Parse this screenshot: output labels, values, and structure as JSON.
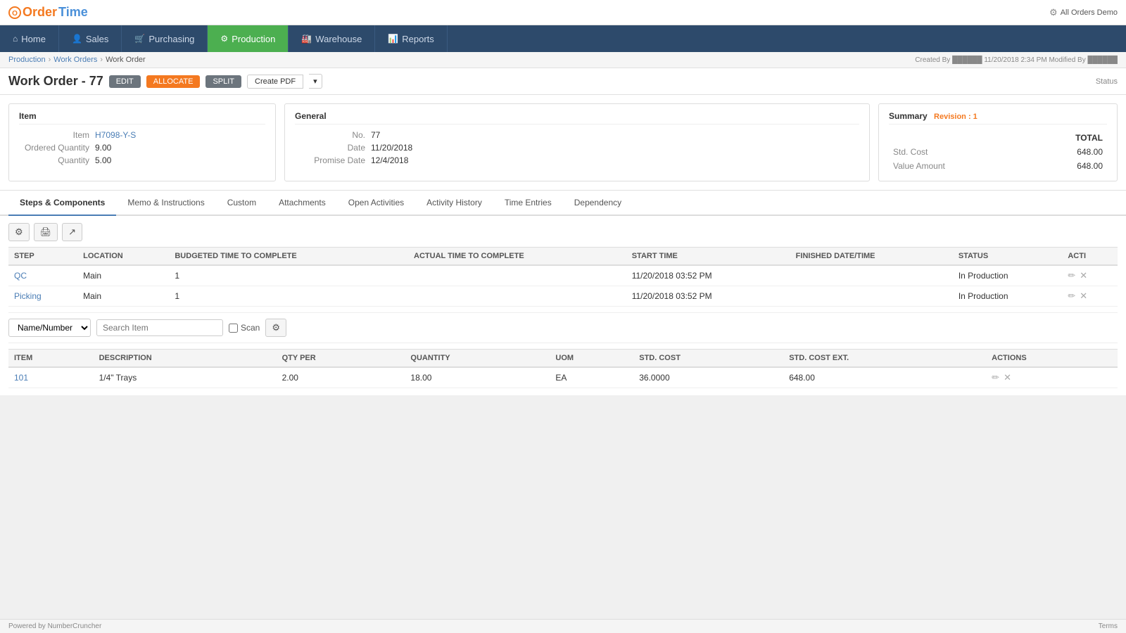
{
  "app": {
    "logo_order": "Order",
    "logo_time": "Time",
    "top_right": "All Orders Demo"
  },
  "nav": {
    "items": [
      {
        "id": "home",
        "label": "Home",
        "icon": "⌂",
        "active": false
      },
      {
        "id": "sales",
        "label": "Sales",
        "icon": "👤",
        "active": false
      },
      {
        "id": "purchasing",
        "label": "Purchasing",
        "icon": "🛒",
        "active": false
      },
      {
        "id": "production",
        "label": "Production",
        "icon": "⚙",
        "active": true
      },
      {
        "id": "warehouse",
        "label": "Warehouse",
        "icon": "🏭",
        "active": false
      },
      {
        "id": "reports",
        "label": "Reports",
        "icon": "📊",
        "active": false
      }
    ]
  },
  "breadcrumb": {
    "items": [
      "Production",
      "Work Orders",
      "Work Order"
    ],
    "separator": "›"
  },
  "created_info": "Created By ██████ 11/20/2018 2:34 PM  Modified By ██████",
  "page": {
    "title": "Work Order - 77",
    "btn_edit": "EDIT",
    "btn_allocate": "ALLOCATE",
    "btn_split": "SPLIT",
    "btn_create_pdf": "Create PDF",
    "btn_status": "Status"
  },
  "item_panel": {
    "heading": "Item",
    "item_label": "Item",
    "item_value": "H7098-Y-S",
    "ordered_qty_label": "Ordered Quantity",
    "ordered_qty_value": "9.00",
    "quantity_label": "Quantity",
    "quantity_value": "5.00"
  },
  "general_panel": {
    "heading": "General",
    "no_label": "No.",
    "no_value": "77",
    "date_label": "Date",
    "date_value": "11/20/2018",
    "promise_date_label": "Promise Date",
    "promise_date_value": "12/4/2018"
  },
  "summary_panel": {
    "heading": "Summary",
    "revision": "Revision : 1",
    "col_total": "TOTAL",
    "std_cost_label": "Std. Cost",
    "std_cost_value": "648.00",
    "value_amount_label": "Value Amount",
    "value_amount_value": "648.00"
  },
  "tabs": [
    {
      "id": "steps",
      "label": "Steps & Components",
      "active": true
    },
    {
      "id": "memo",
      "label": "Memo & Instructions",
      "active": false
    },
    {
      "id": "custom",
      "label": "Custom",
      "active": false
    },
    {
      "id": "attachments",
      "label": "Attachments",
      "active": false
    },
    {
      "id": "open_activities",
      "label": "Open Activities",
      "active": false
    },
    {
      "id": "activity_history",
      "label": "Activity History",
      "active": false
    },
    {
      "id": "time_entries",
      "label": "Time Entries",
      "active": false
    },
    {
      "id": "dependency",
      "label": "Dependency",
      "active": false
    }
  ],
  "steps_table": {
    "columns": [
      "STEP",
      "LOCATION",
      "BUDGETED TIME TO COMPLETE",
      "ACTUAL TIME TO COMPLETE",
      "START TIME",
      "FINISHED DATE/TIME",
      "STATUS",
      "ACTI"
    ],
    "rows": [
      {
        "step": "QC",
        "location": "Main",
        "budgeted": "1",
        "actual": "",
        "start_time": "11/20/2018 03:52 PM",
        "finished": "",
        "status": "In Production"
      },
      {
        "step": "Picking",
        "location": "Main",
        "budgeted": "1",
        "actual": "",
        "start_time": "11/20/2018 03:52 PM",
        "finished": "",
        "status": "In Production"
      }
    ]
  },
  "component_filter": {
    "dropdown_default": "Name/Number",
    "search_placeholder": "Search Item",
    "scan_label": "Scan"
  },
  "components_table": {
    "columns": [
      "ITEM",
      "DESCRIPTION",
      "QTY PER",
      "QUANTITY",
      "UOM",
      "STD. COST",
      "STD. COST EXT.",
      "ACTIONS"
    ],
    "rows": [
      {
        "item": "101",
        "description": "1/4\" Trays",
        "qty_per": "2.00",
        "quantity": "18.00",
        "uom": "EA",
        "std_cost": "36.0000",
        "std_cost_ext": "648.00"
      }
    ]
  },
  "footer": {
    "left": "Powered by NumberCruncher",
    "right": "Terms"
  }
}
